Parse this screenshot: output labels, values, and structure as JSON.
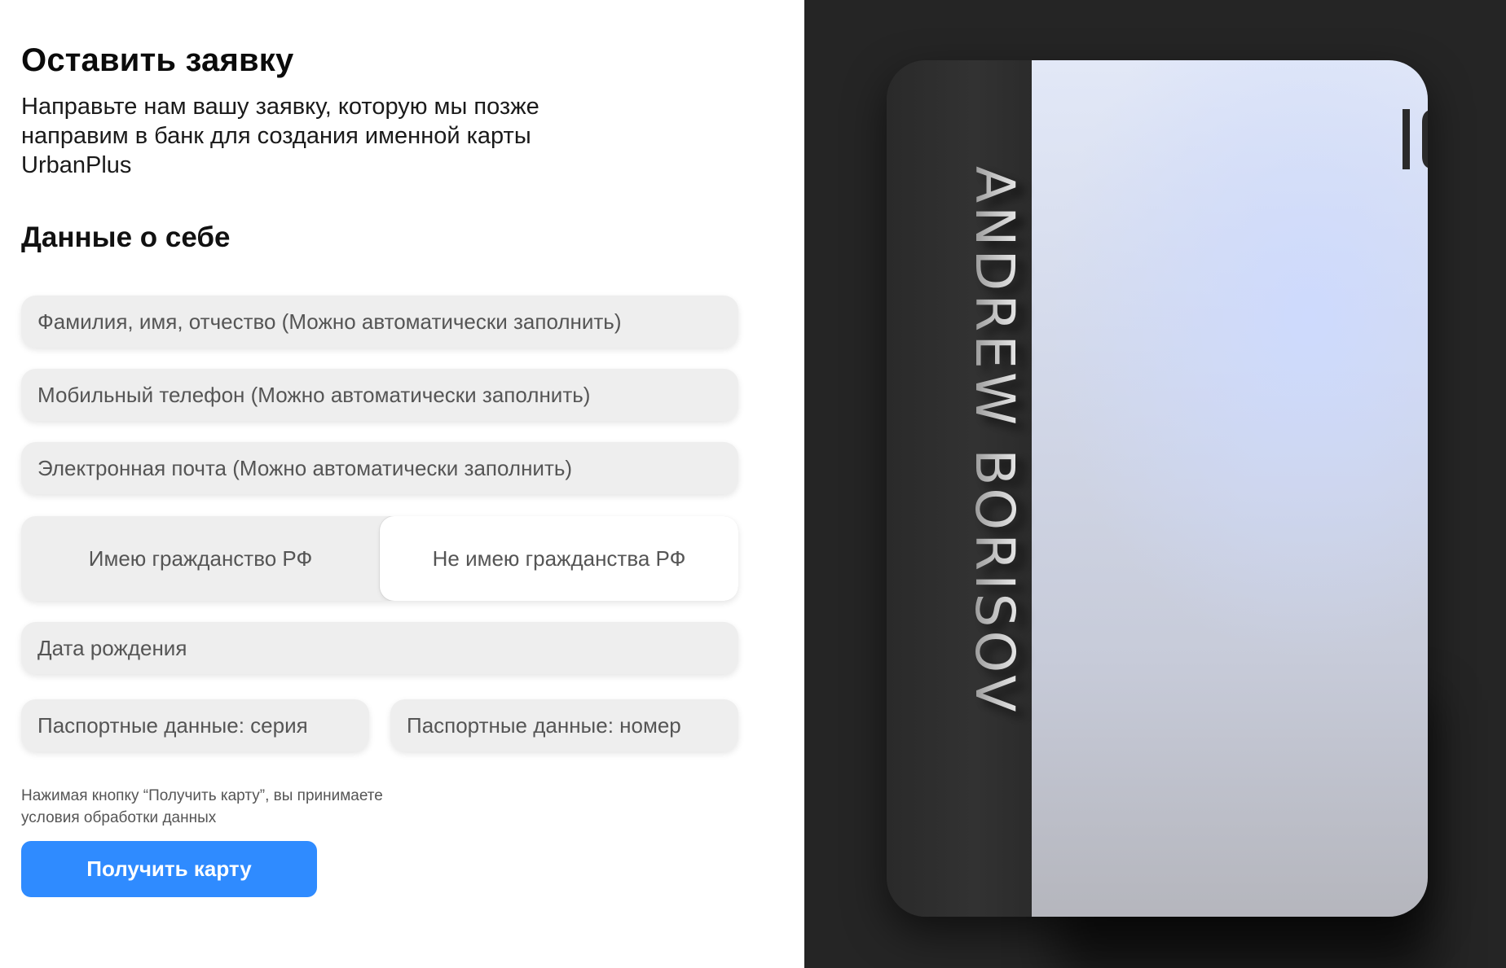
{
  "form": {
    "title": "Оставить заявку",
    "subtitle": "Направьте нам вашу заявку, которую мы позже направим в банк для создания именной карты UrbanPlus",
    "section_heading": "Данные о себе",
    "fields": {
      "fio_placeholder": "Фамилия, имя, отчество (Можно автоматически заполнить)",
      "phone_placeholder": "Мобильный телефон (Можно автоматически заполнить)",
      "email_placeholder": "Электронная почта (Можно автоматически заполнить)",
      "birthdate_placeholder": "Дата рождения",
      "passport_series_placeholder": "Паспортные данные: серия",
      "passport_number_placeholder": "Паспортные данные: номер"
    },
    "citizenship": {
      "options": [
        "Имею гражданство РФ",
        "Не имею гражданства РФ"
      ],
      "selected": "Не имею гражданства РФ"
    },
    "consent_text": "Нажимая кнопку “Получить карту”, вы принимаете условия обработки данных",
    "submit_label": "Получить карту"
  },
  "card": {
    "holder_name": "ANDREW BORISOV",
    "logo_icon": "ic-logo-icon"
  },
  "colors": {
    "accent": "#2f8bff",
    "field_bg": "#eeeeee",
    "right_panel_bg": "#252525"
  }
}
